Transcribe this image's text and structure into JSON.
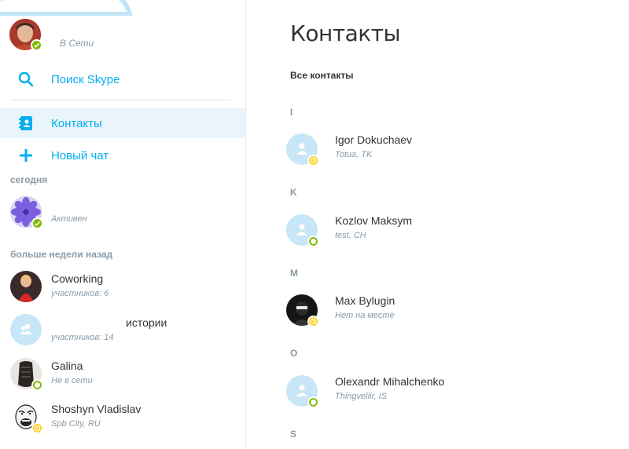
{
  "profile": {
    "status": "В Сети"
  },
  "sidebar": {
    "search_label": "Поиск Skype",
    "contacts_label": "Контакты",
    "new_chat_label": "Новый чат",
    "section_today": "сегодня",
    "section_older": "больше недели назад",
    "today_items": [
      {
        "title": "",
        "sub": "Активен",
        "status": "online"
      }
    ],
    "older_items": [
      {
        "title": "Coworking",
        "sub": "участников: 6"
      },
      {
        "title": "истории",
        "sub": "участников: 14"
      },
      {
        "title": "Galina",
        "sub": "Не в сети",
        "status": "offline"
      },
      {
        "title": "Shoshyn Vladislav",
        "sub": "Spb City, RU",
        "status": "away"
      }
    ]
  },
  "main": {
    "title": "Контакты",
    "subheader": "Все контакты",
    "groups": [
      {
        "letter": "I",
        "contacts": [
          {
            "name": "Igor Dokuchaev",
            "sub": "Totua, TK",
            "status": "away"
          }
        ]
      },
      {
        "letter": "K",
        "contacts": [
          {
            "name": "Kozlov Maksym",
            "sub": "test, CH",
            "status": "offline"
          }
        ]
      },
      {
        "letter": "M",
        "contacts": [
          {
            "name": "Max Bylugin",
            "sub": "Нет на месте",
            "status": "away"
          }
        ]
      },
      {
        "letter": "O",
        "contacts": [
          {
            "name": "Olexandr Mihalchenko",
            "sub": "Thingvellir, IS",
            "status": "offline"
          }
        ]
      },
      {
        "letter": "S",
        "contacts": []
      }
    ]
  },
  "colors": {
    "accent": "#00aff0",
    "online": "#7fba00",
    "away": "#fcd116",
    "muted": "#8a9aa6",
    "active_bg": "#eaf5fb",
    "placeholder_avatar": "#c7e6f7"
  },
  "icons": {
    "search": "search-icon",
    "contacts": "contacts-book-icon",
    "new_chat": "plus-icon",
    "group": "group-icon",
    "person": "person-icon"
  }
}
